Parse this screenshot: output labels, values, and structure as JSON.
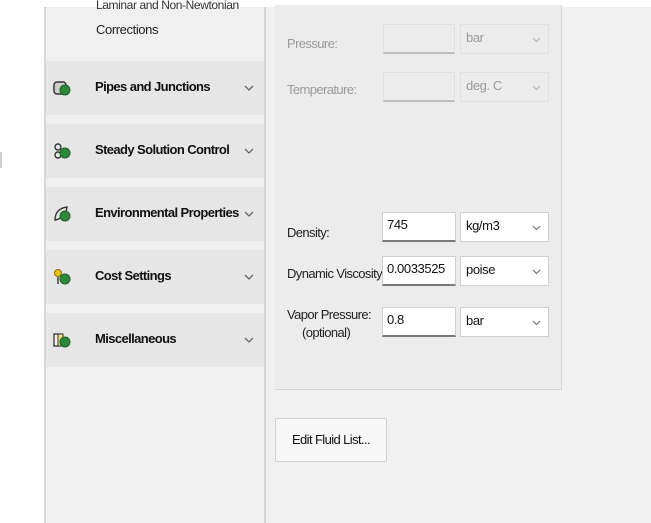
{
  "sidebar": {
    "cutoff_line1": "Laminar and Non-Newtonian",
    "cutoff_line2": "Corrections",
    "items": [
      {
        "label": "Pipes and Junctions",
        "icon": "pipe-icon",
        "color": "#2a8a3a"
      },
      {
        "label": "Steady Solution Control",
        "icon": "solution-control-icon",
        "color": "#2a8a3a"
      },
      {
        "label": "Environmental Properties",
        "icon": "environment-icon",
        "color": "#2a8a3a"
      },
      {
        "label": "Cost Settings",
        "icon": "cost-icon",
        "color": "#2a8a3a"
      },
      {
        "label": "Miscellaneous",
        "icon": "miscellaneous-icon",
        "color": "#2a8a3a"
      }
    ]
  },
  "fluid": {
    "pressure": {
      "label": "Pressure:",
      "value": "",
      "unit": "bar"
    },
    "temperature": {
      "label": "Temperature:",
      "value": "",
      "unit": "deg. C"
    },
    "density": {
      "label": "Density:",
      "value": "745",
      "unit": "kg/m3"
    },
    "viscosity": {
      "label": "Dynamic Viscosity:",
      "value": "0.0033525",
      "unit": "poise"
    },
    "vapor": {
      "label_line1": "Vapor Pressure:",
      "label_line2": "(optional)",
      "value": "0.8",
      "unit": "bar"
    }
  },
  "buttons": {
    "edit_fluid_list": "Edit Fluid List..."
  }
}
